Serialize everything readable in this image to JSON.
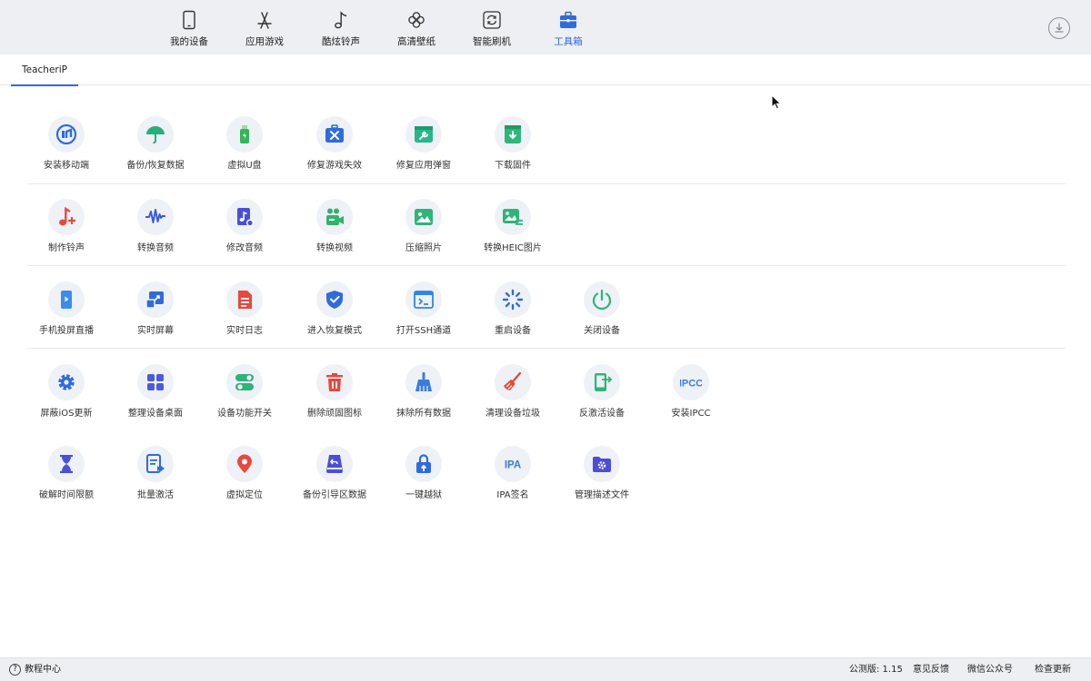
{
  "nav": {
    "items": [
      {
        "label": "我的设备",
        "icon": "phone-icon"
      },
      {
        "label": "应用游戏",
        "icon": "app-store-icon"
      },
      {
        "label": "酷炫铃声",
        "icon": "music-note-icon"
      },
      {
        "label": "高清壁纸",
        "icon": "flower-icon"
      },
      {
        "label": "智能刷机",
        "icon": "refresh-icon"
      },
      {
        "label": "工具箱",
        "icon": "toolbox-icon"
      }
    ],
    "active": "工具箱",
    "download_icon": "download-icon",
    "accent": "#2f6bdc"
  },
  "tabs": [
    {
      "label": "TeacheriP"
    }
  ],
  "tools": [
    [
      {
        "label": "安装移动端",
        "icon": "install-mobile-icon"
      },
      {
        "label": "备份/恢复数据",
        "icon": "umbrella-icon"
      },
      {
        "label": "虚拟U盘",
        "icon": "usb-drive-icon"
      },
      {
        "label": "修复游戏失效",
        "icon": "repair-toolkit-icon"
      },
      {
        "label": "修复应用弹窗",
        "icon": "repair-window-icon"
      },
      {
        "label": "下载固件",
        "icon": "download-firmware-icon"
      }
    ],
    [
      {
        "label": "制作铃声",
        "icon": "ringtone-icon"
      },
      {
        "label": "转换音频",
        "icon": "waveform-icon"
      },
      {
        "label": "修改音频",
        "icon": "audio-file-icon"
      },
      {
        "label": "转换视频",
        "icon": "video-camera-icon"
      },
      {
        "label": "压缩照片",
        "icon": "photo-icon"
      },
      {
        "label": "转换HEIC图片",
        "icon": "heic-image-icon"
      }
    ],
    [
      {
        "label": "手机投屏直播",
        "icon": "screen-cast-icon"
      },
      {
        "label": "实时屏幕",
        "icon": "live-screen-icon"
      },
      {
        "label": "实时日志",
        "icon": "log-file-icon"
      },
      {
        "label": "进入恢复模式",
        "icon": "shield-check-icon"
      },
      {
        "label": "打开SSH通道",
        "icon": "terminal-icon"
      },
      {
        "label": "重启设备",
        "icon": "spinner-icon"
      },
      {
        "label": "关闭设备",
        "icon": "power-icon"
      }
    ],
    [
      {
        "label": "屏蔽iOS更新",
        "icon": "gear-icon"
      },
      {
        "label": "整理设备桌面",
        "icon": "grid-icon"
      },
      {
        "label": "设备功能开关",
        "icon": "toggle-icon"
      },
      {
        "label": "删除顽固图标",
        "icon": "trash-icon"
      },
      {
        "label": "抹除所有数据",
        "icon": "broom-icon"
      },
      {
        "label": "清理设备垃圾",
        "icon": "cleaning-brush-icon"
      },
      {
        "label": "反激活设备",
        "icon": "deactivate-phone-icon"
      },
      {
        "label": "安装IPCC",
        "icon": "ipcc-icon",
        "text": "IPCC"
      }
    ],
    [
      {
        "label": "破解时间限额",
        "icon": "hourglass-icon"
      },
      {
        "label": "批量激活",
        "icon": "batch-activate-icon"
      },
      {
        "label": "虚拟定位",
        "icon": "location-pin-icon"
      },
      {
        "label": "备份引导区数据",
        "icon": "boot-backup-icon"
      },
      {
        "label": "一键越狱",
        "icon": "unlock-icon"
      },
      {
        "label": "IPA签名",
        "icon": "ipa-icon",
        "text": "IPA"
      },
      {
        "label": "管理描述文件",
        "icon": "profile-folder-icon"
      }
    ]
  ],
  "status": {
    "help_label": "教程中心",
    "version": "公测版: 1.15",
    "feedback": "意见反馈",
    "wechat": "微信公众号",
    "update": "检查更新"
  }
}
